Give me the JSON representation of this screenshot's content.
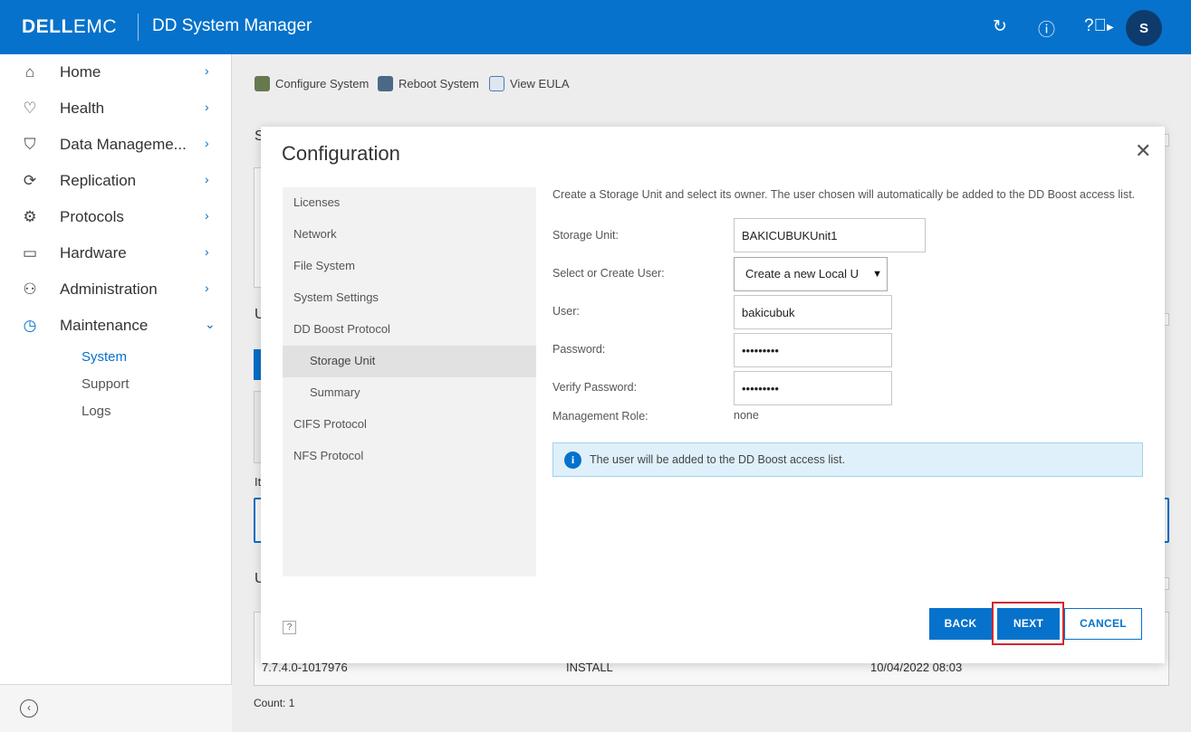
{
  "header": {
    "brand_main": "DELL",
    "brand_sub": "EMC",
    "app_title": "DD System Manager",
    "avatar_initial": "S"
  },
  "sidebar": {
    "items": [
      {
        "label": "Home"
      },
      {
        "label": "Health"
      },
      {
        "label": "Data Manageme..."
      },
      {
        "label": "Replication"
      },
      {
        "label": "Protocols"
      },
      {
        "label": "Hardware"
      },
      {
        "label": "Administration"
      },
      {
        "label": "Maintenance"
      }
    ],
    "sub_items": [
      {
        "label": "System"
      },
      {
        "label": "Support"
      },
      {
        "label": "Logs"
      }
    ]
  },
  "toolbar": {
    "configure_system": "Configure System",
    "reboot_system": "Reboot System",
    "view_eula": "View EULA"
  },
  "background": {
    "heading_s": "S",
    "heading_u1": "U",
    "text_it": "It",
    "heading_u2": "U",
    "row_version": "7.7.4.0-1017976",
    "row_type": "INSTALL",
    "row_date": "10/04/2022 08:03",
    "count": "Count: 1"
  },
  "modal": {
    "title": "Configuration",
    "steps": [
      {
        "label": "Licenses"
      },
      {
        "label": "Network"
      },
      {
        "label": "File System"
      },
      {
        "label": "System Settings"
      },
      {
        "label": "DD Boost Protocol"
      },
      {
        "label": "Storage Unit"
      },
      {
        "label": "Summary"
      },
      {
        "label": "CIFS Protocol"
      },
      {
        "label": "NFS Protocol"
      }
    ],
    "intro": "Create a Storage Unit and select its owner. The user chosen will automatically be added to the DD Boost access list.",
    "fields": {
      "storage_unit_label": "Storage Unit:",
      "storage_unit_value": "BAKICUBUKUnit1",
      "select_user_label": "Select or Create User:",
      "select_user_value": "Create a new Local U",
      "user_label": "User:",
      "user_value": "bakicubuk",
      "password_label": "Password:",
      "password_value": "•••••••••",
      "verify_label": "Verify Password:",
      "verify_value": "•••••••••",
      "role_label": "Management Role:",
      "role_value": "none"
    },
    "info": "The user will be added to the DD Boost access list.",
    "help": "?",
    "back": "BACK",
    "next": "NEXT",
    "cancel": "CANCEL"
  },
  "colors": {
    "accent": "#0672cb",
    "highlight": "#d2262e"
  }
}
